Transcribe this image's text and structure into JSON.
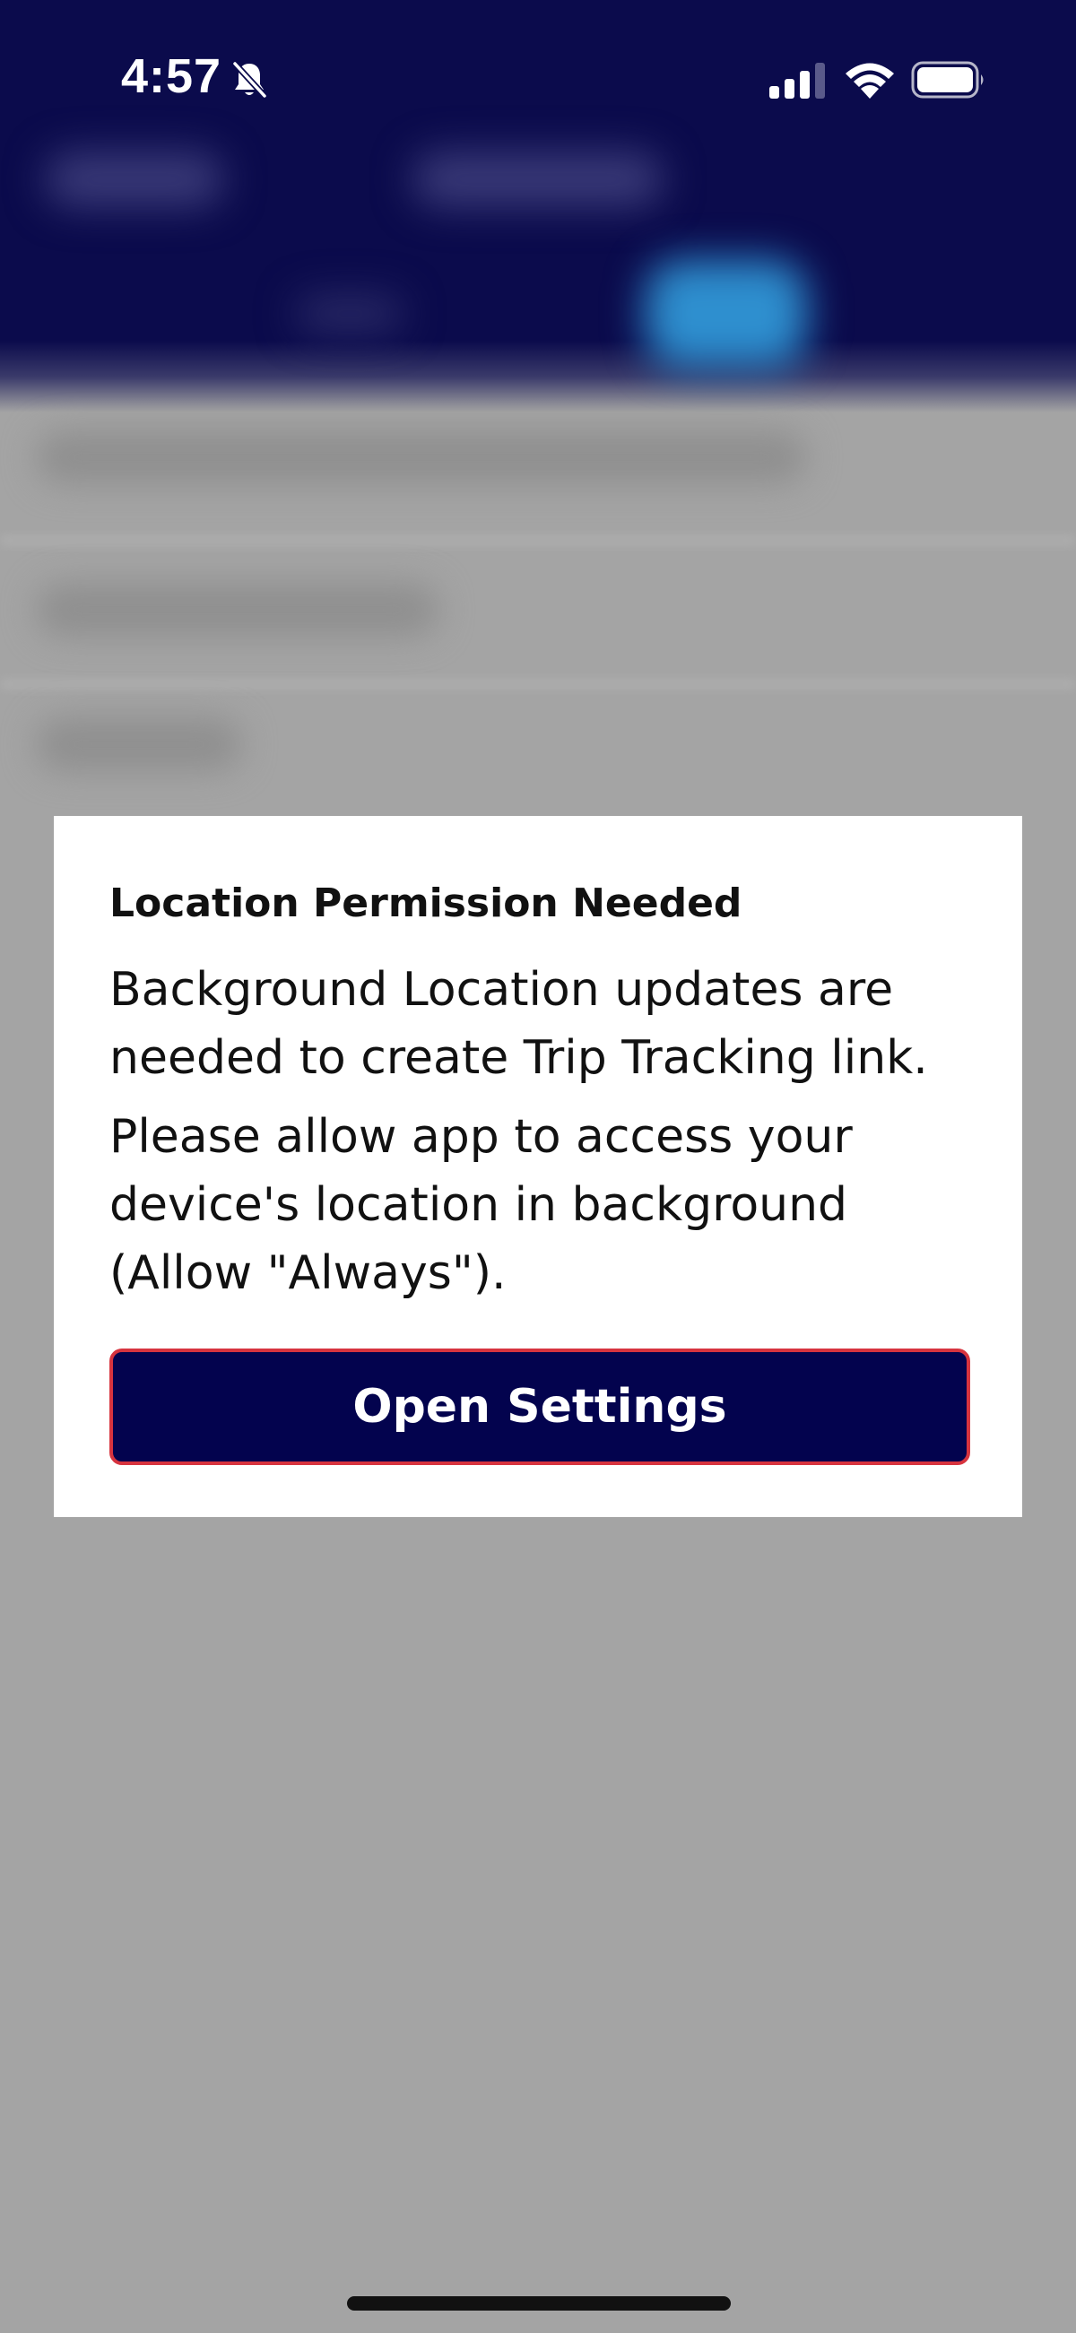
{
  "status_bar": {
    "time": "4:57",
    "icons": [
      "bell-slash-icon",
      "cellular-signal-icon",
      "wifi-icon",
      "battery-icon"
    ]
  },
  "colors": {
    "header_navy": "#0b0b4c",
    "button_navy": "#03034e",
    "button_border": "#d7343f",
    "overlay_gray": "#a4a4a4",
    "dialog_bg": "#ffffff"
  },
  "dialog": {
    "title": "Location Permission Needed",
    "message_1": "Background Location updates are needed to create Trip Tracking link.",
    "message_2": "Please allow app to access your device's location in background (Allow \"Always\").",
    "button_label": "Open Settings"
  }
}
